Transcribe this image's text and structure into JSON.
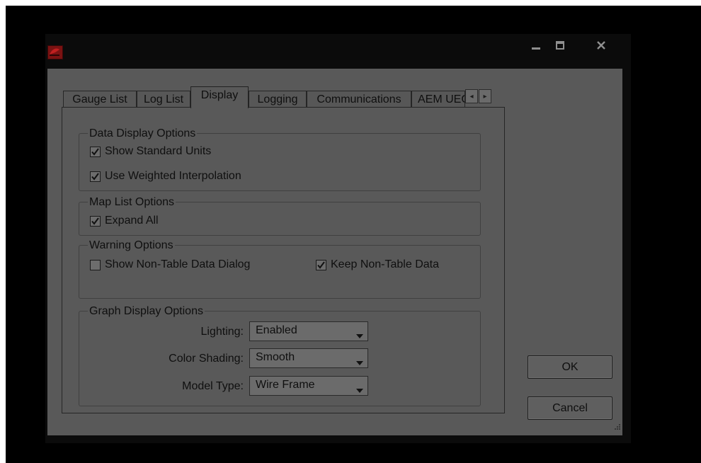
{
  "window": {
    "app_icon": "app-logo-icon",
    "controls": {
      "minimize": "minimize-icon",
      "maximize": "maximize-icon",
      "close": "close-icon"
    }
  },
  "tabs": [
    {
      "label": "Gauge List",
      "active": false
    },
    {
      "label": "Log List",
      "active": false
    },
    {
      "label": "Display",
      "active": true
    },
    {
      "label": "Logging",
      "active": false
    },
    {
      "label": "Communications",
      "active": false
    },
    {
      "label": "AEM UEGO",
      "active": false
    }
  ],
  "tab_scroll": {
    "left_icon": "arrow-left-icon",
    "right_icon": "arrow-right-icon"
  },
  "groups": {
    "data_display": {
      "title": "Data Display Options",
      "show_standard_units": {
        "label": "Show Standard Units",
        "checked": true
      },
      "use_weighted_interpolation": {
        "label": "Use Weighted Interpolation",
        "checked": true
      }
    },
    "map_list": {
      "title": "Map List Options",
      "expand_all": {
        "label": "Expand All",
        "checked": true
      }
    },
    "warning": {
      "title": "Warning Options",
      "show_non_table_data_dialog": {
        "label": "Show Non-Table Data Dialog",
        "checked": false
      },
      "keep_non_table_data": {
        "label": "Keep Non-Table Data",
        "checked": true
      }
    },
    "graph_display": {
      "title": "Graph Display Options",
      "lighting": {
        "label": "Lighting:",
        "value": "Enabled"
      },
      "color_shading": {
        "label": "Color Shading:",
        "value": "Smooth"
      },
      "model_type": {
        "label": "Model Type:",
        "value": "Wire Frame"
      }
    }
  },
  "buttons": {
    "ok": "OK",
    "cancel": "Cancel"
  },
  "colors": {
    "background": "#000000",
    "dialog_face": "#595959",
    "text": "#0f0f0f",
    "icon_red": "#7a1212"
  }
}
